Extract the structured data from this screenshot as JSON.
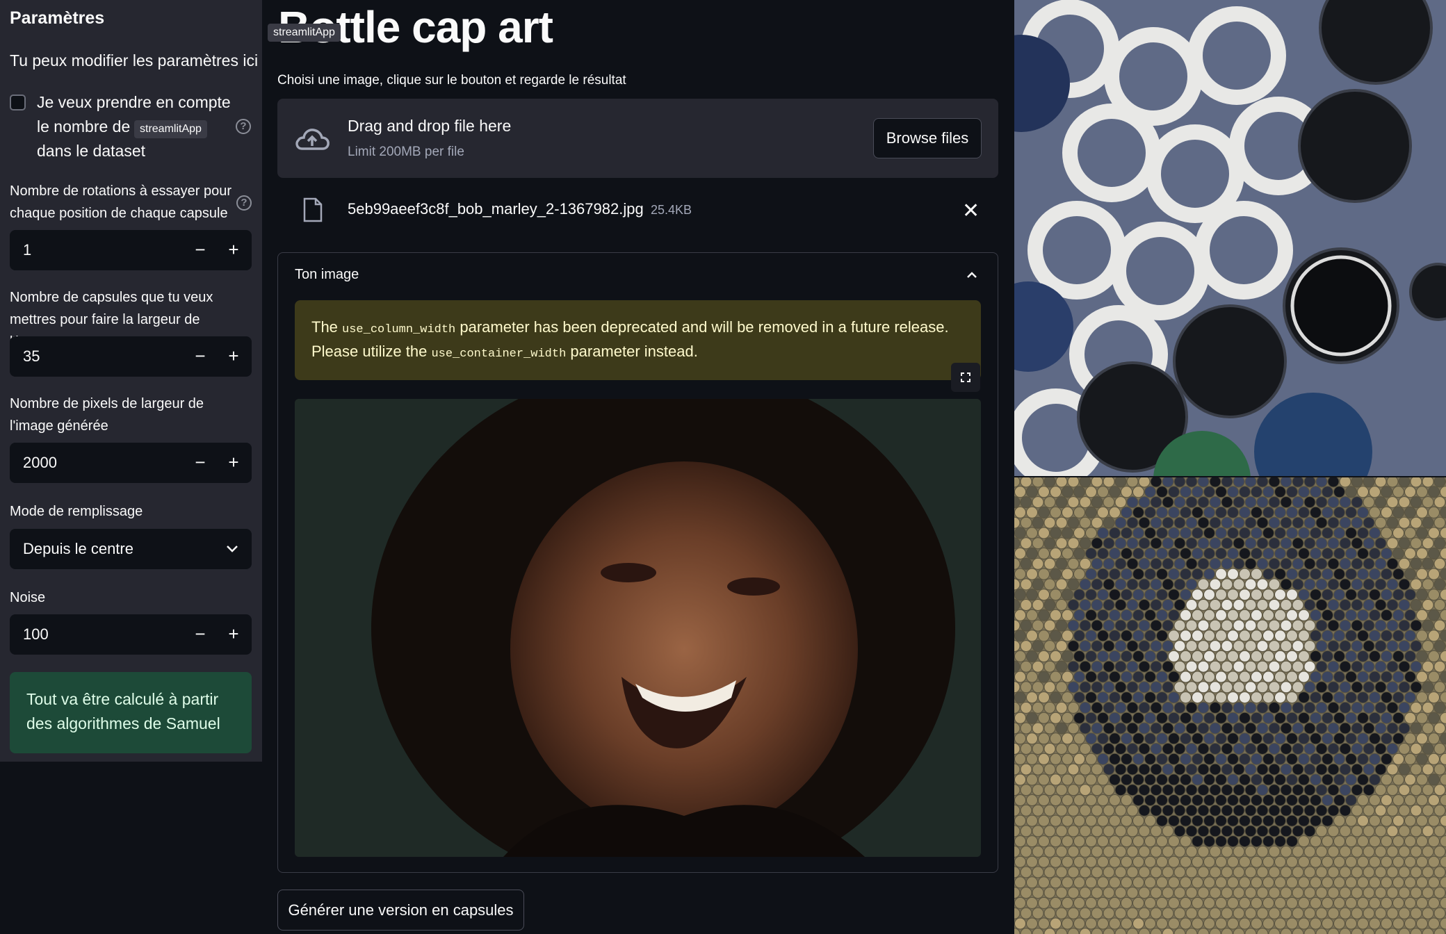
{
  "sidebar": {
    "title": "Paramètres",
    "subtitle": "Tu peux modifier les paramètres ici",
    "checkbox_label": "Je veux prendre en compte le nombre de capsules dans le dataset",
    "checkbox_checked": false,
    "rotations_label": "Nombre de rotations à essayer pour chaque position de chaque capsule",
    "rotations_value": "1",
    "capsules_label": "Nombre de capsules que tu veux mettres pour faire la largeur de l'image",
    "capsules_value": "35",
    "pixels_label": "Nombre de pixels de largeur de l'image générée",
    "pixels_value": "2000",
    "fill_mode_label": "Mode de remplissage",
    "fill_mode_value": "Depuis le centre",
    "noise_label": "Noise",
    "noise_value": "100",
    "info_text": "Tout va être calculé à partir des algorithmes de Samuel",
    "minus": "−",
    "plus": "+",
    "help": "?"
  },
  "tooltips": {
    "top": "streamlitApp",
    "sidebar": "streamlitApp"
  },
  "main": {
    "title": "Bottle cap art",
    "subtitle": "Choisi une image, clique sur le bouton et regarde le résultat",
    "uploader": {
      "drag_text": "Drag and drop file here",
      "limit_text": "Limit 200MB per file",
      "browse_label": "Browse files"
    },
    "file": {
      "name": "5eb99aeef3c8f_bob_marley_2-1367982.jpg",
      "size": "25.4KB",
      "close": "✕"
    },
    "expander": {
      "title": "Ton image",
      "warning_prefix": "The ",
      "warning_code1": "use_column_width",
      "warning_mid": " parameter has been deprecated and will be removed in a future release.",
      "warning_line2_prefix": "Please utilize the ",
      "warning_code2": "use_container_width",
      "warning_line2_suffix": " parameter instead."
    },
    "generate_label": "Générer une version en capsules"
  },
  "colors": {
    "background": "#0e1117",
    "sidebar": "#262730",
    "success": "#1d4a38",
    "warning": "#3d3a1a"
  }
}
